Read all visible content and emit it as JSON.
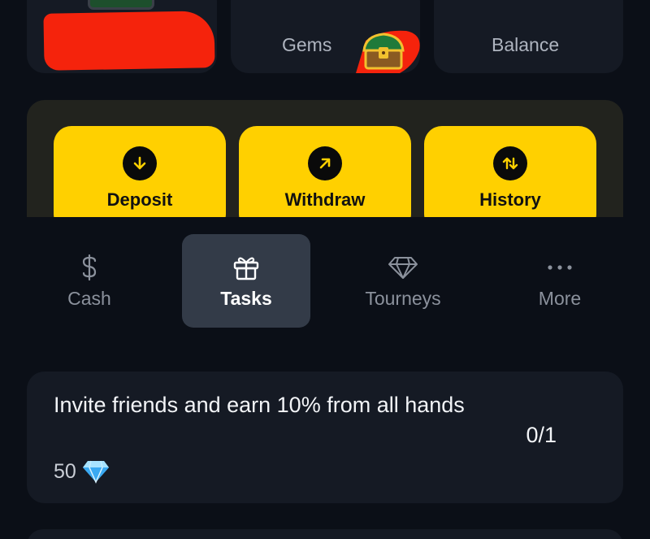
{
  "stats": {
    "gems_label": "Gems",
    "balance_label": "Balance"
  },
  "actions": [
    {
      "label": "Deposit",
      "icon": "arrow-down-icon"
    },
    {
      "label": "Withdraw",
      "icon": "arrow-up-right-icon"
    },
    {
      "label": "History",
      "icon": "arrows-up-down-icon"
    }
  ],
  "tabs": [
    {
      "label": "Cash",
      "icon": "dollar-icon",
      "active": false
    },
    {
      "label": "Tasks",
      "icon": "gift-icon",
      "active": true
    },
    {
      "label": "Tourneys",
      "icon": "diamond-icon",
      "active": false
    },
    {
      "label": "More",
      "icon": "ellipsis-icon",
      "active": false
    }
  ],
  "task": {
    "title": "Invite friends and earn 10% from all hands",
    "progress": "0/1",
    "reward": "50",
    "reward_icon": "gem-icon"
  },
  "colors": {
    "background": "#0b0f17",
    "card": "#151a24",
    "accent_yellow": "#ffd000",
    "active_tab": "#333b48",
    "redaction": "#f5230c"
  }
}
